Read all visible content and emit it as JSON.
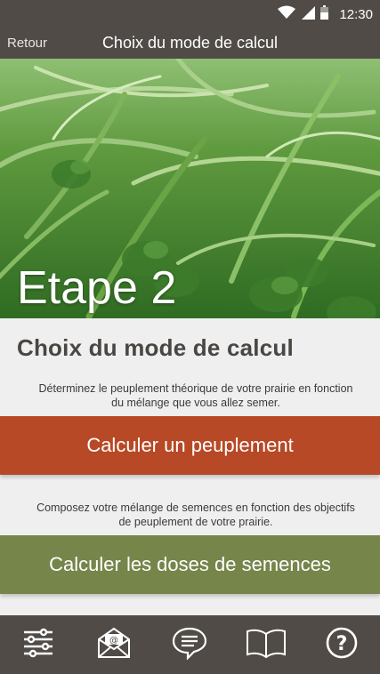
{
  "status_bar": {
    "time": "12:30"
  },
  "header": {
    "back_label": "Retour",
    "title": "Choix du mode de calcul"
  },
  "hero": {
    "step_label": "Etape 2"
  },
  "content": {
    "section_title": "Choix du mode de calcul",
    "peuplement_description": "Déterminez le peuplement théorique de votre prairie en fonction du mélange que vous allez semer.",
    "peuplement_button": "Calculer un peuplement",
    "doses_description": "Composez votre mélange de semences en fonction des objectifs de peuplement de votre prairie.",
    "doses_button": "Calculer les doses de semences"
  },
  "toolbar": {
    "items": [
      {
        "icon": "settings-sliders-icon"
      },
      {
        "icon": "mail-icon"
      },
      {
        "icon": "chat-icon"
      },
      {
        "icon": "book-icon"
      },
      {
        "icon": "help-icon"
      }
    ]
  },
  "colors": {
    "bar_background": "#504b46",
    "peuplement_button": "#b74926",
    "doses_button": "#76854a",
    "page_background": "#efefef"
  }
}
